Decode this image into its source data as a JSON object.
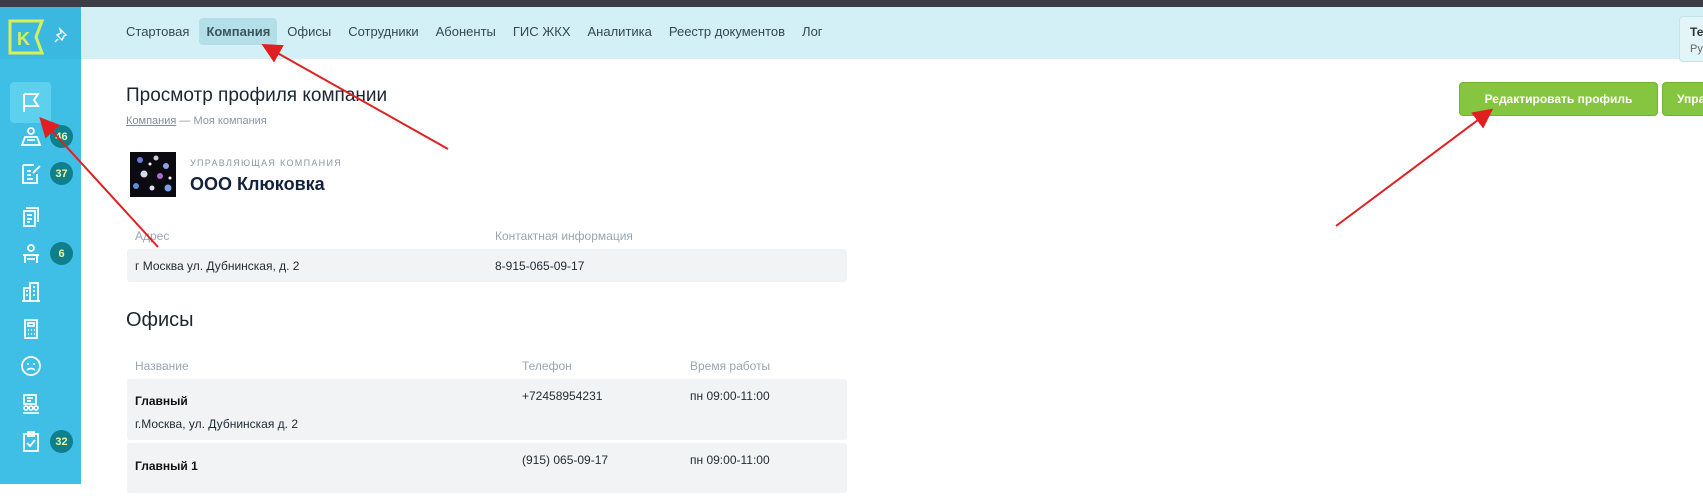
{
  "app": {
    "logo_letter": "K",
    "accent": "#3fbfe6",
    "brand_green": "#86c540",
    "badge_color": "#0f7f8c"
  },
  "sidebar": {
    "items": [
      {
        "icon": "flag-icon",
        "active": true
      },
      {
        "icon": "people-group-icon",
        "badge": "46"
      },
      {
        "icon": "edit-document-icon",
        "badge": "37"
      },
      {
        "icon": "documents-icon"
      },
      {
        "icon": "person-desk-icon",
        "badge": "6"
      },
      {
        "icon": "building-icon"
      },
      {
        "icon": "calculator-icon"
      },
      {
        "icon": "sad-face-icon"
      },
      {
        "icon": "team-icon"
      },
      {
        "icon": "checklist-icon",
        "badge": "32"
      }
    ]
  },
  "topnav": {
    "tabs": [
      {
        "label": "Стартовая"
      },
      {
        "label": "Компания",
        "active": true
      },
      {
        "label": "Офисы"
      },
      {
        "label": "Сотрудники"
      },
      {
        "label": "Абоненты"
      },
      {
        "label": "ГИС ЖКХ"
      },
      {
        "label": "Аналитика"
      },
      {
        "label": "Реестр документов"
      },
      {
        "label": "Лог"
      }
    ]
  },
  "user": {
    "line1": "Те",
    "line2": "Ру"
  },
  "page": {
    "title": "Просмотр профиля компании",
    "breadcrumb_link": "Компания",
    "breadcrumb_sep": " — ",
    "breadcrumb_current": "Моя компания",
    "edit_button": "Редактировать профиль",
    "manage_button": "Упра"
  },
  "company": {
    "type": "УПРАВЛЯЮЩАЯ КОМПАНИЯ",
    "name": "ООО Клюковка",
    "address_header": "Адрес",
    "contact_header": "Контактная информация",
    "address": "г Москва ул. Дубнинская, д. 2",
    "contact": "8-915-065-09-17"
  },
  "offices": {
    "title": "Офисы",
    "headers": {
      "name": "Название",
      "phone": "Телефон",
      "hours": "Время работы"
    },
    "rows": [
      {
        "name": "Главный",
        "address": "г.Москва, ул. Дубнинская д. 2",
        "phone": "+72458954231",
        "hours": "пн 09:00-11:00"
      },
      {
        "name": "Главный 1",
        "address": "",
        "phone": "(915) 065-09-17",
        "hours": "пн 09:00-11:00"
      }
    ]
  }
}
